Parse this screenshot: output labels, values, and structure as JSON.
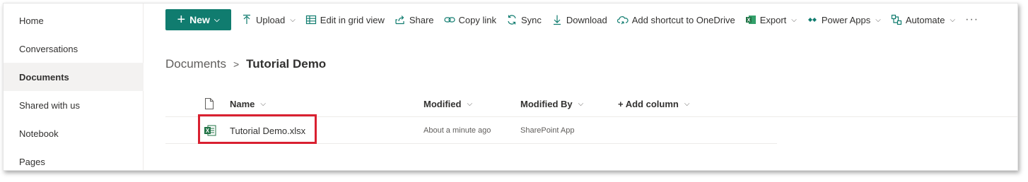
{
  "nav": {
    "items": [
      {
        "label": "Home",
        "selected": false
      },
      {
        "label": "Conversations",
        "selected": false
      },
      {
        "label": "Documents",
        "selected": true
      },
      {
        "label": "Shared with us",
        "selected": false
      },
      {
        "label": "Notebook",
        "selected": false
      },
      {
        "label": "Pages",
        "selected": false
      }
    ]
  },
  "commandbar": {
    "new_label": "New",
    "upload": "Upload",
    "edit_grid": "Edit in grid view",
    "share": "Share",
    "copy_link": "Copy link",
    "sync": "Sync",
    "download": "Download",
    "add_shortcut": "Add shortcut to OneDrive",
    "export": "Export",
    "power_apps": "Power Apps",
    "automate": "Automate",
    "more": "···"
  },
  "breadcrumb": {
    "root": "Documents",
    "separator": ">",
    "current": "Tutorial Demo"
  },
  "list": {
    "columns": {
      "name": "Name",
      "modified": "Modified",
      "modified_by": "Modified By",
      "add_column": "+ Add column"
    },
    "rows": [
      {
        "name": "Tutorial Demo.xlsx",
        "modified": "About a minute ago",
        "modified_by": "SharePoint App",
        "file_icon": "excel-file-icon"
      }
    ]
  },
  "colors": {
    "accent": "#107c6f",
    "highlight_box": "#d92030",
    "excel_green": "#217346"
  }
}
